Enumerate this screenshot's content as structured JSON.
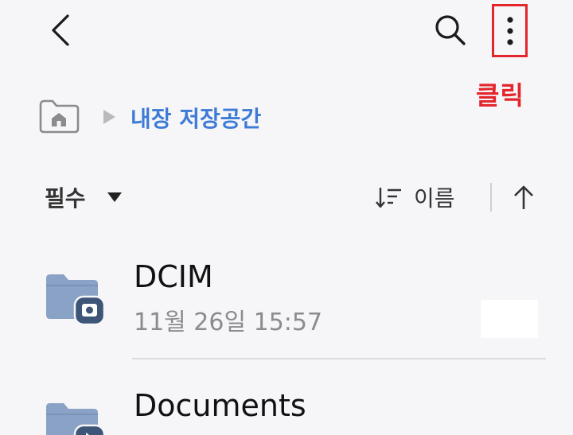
{
  "topbar": {
    "back_icon": "chevron-left-icon",
    "search_icon": "search-icon",
    "more_icon": "more-vertical-icon"
  },
  "annotation": {
    "text": "클릭",
    "color": "#e3262c"
  },
  "breadcrumb": {
    "home_icon": "home-folder-icon",
    "separator_icon": "triangle-right-icon",
    "current": "내장 저장공간"
  },
  "filter": {
    "label": "필수",
    "icon": "caret-down-icon"
  },
  "sort": {
    "icon": "sort-icon",
    "label": "이름",
    "order_icon": "arrow-up-icon"
  },
  "files": [
    {
      "name": "DCIM",
      "date": "11월 26일 15:57",
      "icon": "camera-folder-icon"
    },
    {
      "name": "Documents",
      "date": "",
      "icon": "document-folder-icon"
    }
  ],
  "colors": {
    "background": "#f6f6f9",
    "accent": "#3e7bd6",
    "highlight": "#e3262c",
    "folder": "#8aa2c6",
    "folder_badge": "#3d5577"
  }
}
